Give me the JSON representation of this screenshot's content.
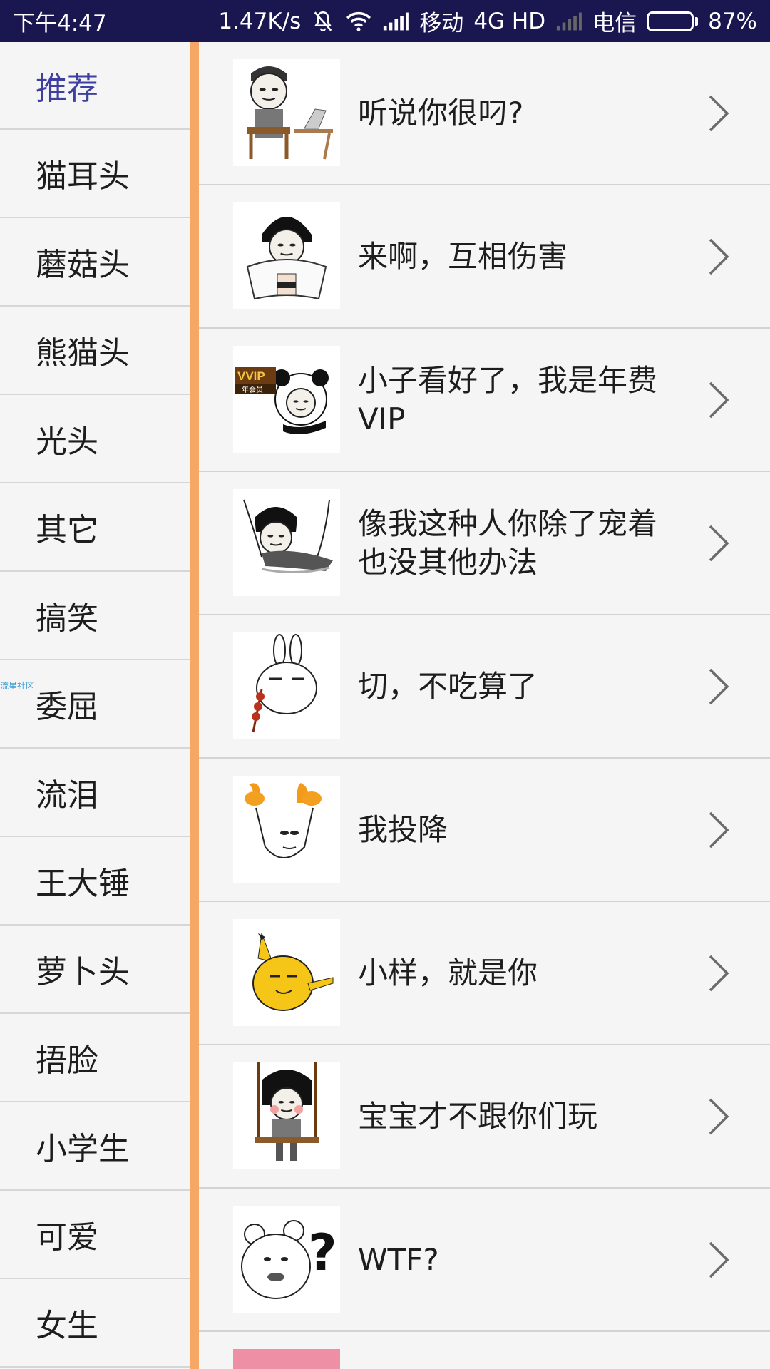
{
  "status_bar": {
    "time": "下午4:47",
    "speed": "1.47K/s",
    "carrier1": "移动",
    "network": "4G HD",
    "carrier2": "电信",
    "battery": "87%",
    "battery_level": 0.87
  },
  "sidebar": {
    "items": [
      {
        "label": "推荐"
      },
      {
        "label": "猫耳头"
      },
      {
        "label": "蘑菇头"
      },
      {
        "label": "熊猫头"
      },
      {
        "label": "光头"
      },
      {
        "label": "其它"
      },
      {
        "label": "搞笑"
      },
      {
        "label": "委屈"
      },
      {
        "label": "流泪"
      },
      {
        "label": "王大锤"
      },
      {
        "label": "萝卜头"
      },
      {
        "label": "捂脸"
      },
      {
        "label": "小学生"
      },
      {
        "label": "可爱"
      },
      {
        "label": "女生"
      }
    ],
    "active_index": 0
  },
  "watermark": "流星社区",
  "list": {
    "items": [
      {
        "title": "听说你很叼?",
        "thumb": "meme-boy-at-desk"
      },
      {
        "title": "来啊，互相伤害",
        "thumb": "meme-mushroom-head-towel"
      },
      {
        "title": "小子看好了，我是年费VIP",
        "thumb": "meme-panda-vip"
      },
      {
        "title": "像我这种人你除了宠着也没其他办法",
        "thumb": "meme-mushroom-lying"
      },
      {
        "title": "切，不吃算了",
        "thumb": "meme-rabbit-skewer"
      },
      {
        "title": "我投降",
        "thumb": "meme-hands-up"
      },
      {
        "title": "小样，就是你",
        "thumb": "meme-pikachu-pointing"
      },
      {
        "title": "宝宝才不跟你们玩",
        "thumb": "meme-swing-girl"
      },
      {
        "title": "WTF?",
        "thumb": "meme-bear-question"
      }
    ]
  },
  "colors": {
    "status_bg": "#1a1650",
    "accent_divider": "#f6a766",
    "active_text": "#3f3f9f"
  }
}
